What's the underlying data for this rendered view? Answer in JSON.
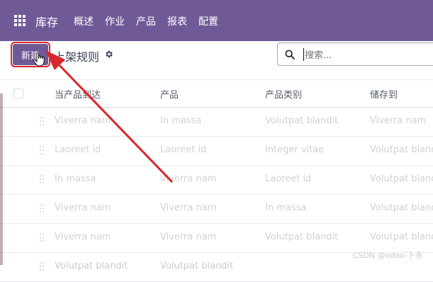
{
  "app": {
    "title": "库存",
    "menu": [
      "概述",
      "作业",
      "产品",
      "报表",
      "配置"
    ]
  },
  "toolbar": {
    "new_button": "新建",
    "breadcrumb": "上架规则"
  },
  "search": {
    "placeholder": "搜索..."
  },
  "table": {
    "columns": [
      "当产品到达",
      "产品",
      "产品类别",
      "储存到"
    ],
    "rows": [
      [
        "Viverra nam",
        "In massa",
        "Volutpat blandit",
        "Viverra nam"
      ],
      [
        "Laoreet id",
        "Laoreet id",
        "Integer vitae",
        "Volutpat blandit"
      ],
      [
        "In massa",
        "Viverra nam",
        "Laoreet id",
        "Volutpat blandit"
      ],
      [
        "Viverra nam",
        "Viverra nam",
        "In massa",
        "Volutpat blandit"
      ],
      [
        "Viverra nam",
        "Viverra nam",
        "Volutpat blandit",
        "Volutpat blandit"
      ],
      [
        "Volutpat blandit",
        "Volutpat blandit",
        "",
        ""
      ]
    ]
  },
  "watermark": "CSDN @odoo-卜永",
  "colors": {
    "brand": "#6f5a97",
    "annotation": "#d9262b"
  }
}
